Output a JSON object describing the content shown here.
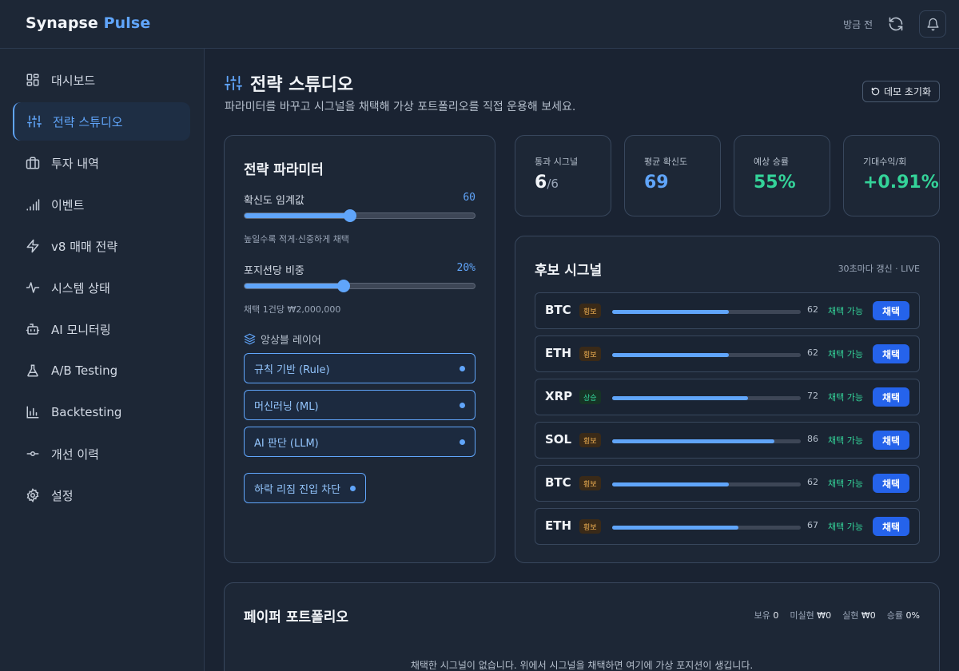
{
  "header": {
    "brand_main": "Synapse",
    "brand_accent": "Pulse",
    "updated": "방금 전",
    "refresh_icon": "refresh-icon",
    "bell_icon": "bell-icon"
  },
  "sidebar": {
    "items": [
      {
        "label": "대시보드",
        "icon": "dashboard-icon"
      },
      {
        "label": "전략 스튜디오",
        "icon": "sliders-icon",
        "active": true
      },
      {
        "label": "투자 내역",
        "icon": "briefcase-icon"
      },
      {
        "label": "이벤트",
        "icon": "signal-bars-icon"
      },
      {
        "label": "v8 매매 전략",
        "icon": "bolt-icon"
      },
      {
        "label": "시스템 상태",
        "icon": "activity-icon"
      },
      {
        "label": "AI 모니터링",
        "icon": "robot-icon"
      },
      {
        "label": "A/B Testing",
        "icon": "flask-icon"
      },
      {
        "label": "Backtesting",
        "icon": "bar-chart-icon"
      },
      {
        "label": "개선 이력",
        "icon": "commit-icon"
      },
      {
        "label": "설정",
        "icon": "gear-icon"
      }
    ]
  },
  "page": {
    "title": "전략 스튜디오",
    "subtitle": "파라미터를 바꾸고 시그널을 채택해 가상 포트폴리오를 직접 운용해 보세요.",
    "reset_label": "데모 초기화"
  },
  "params": {
    "title": "전략 파라미터",
    "confidence_label": "확신도 임계값",
    "confidence_value": "60",
    "confidence_fraction": 0.46,
    "confidence_hint": "높일수록 적게·신중하게 채택",
    "position_label": "포지션당 비중",
    "position_value": "20%",
    "position_fraction": 0.43,
    "position_hint": "채택 1건당 ₩2,000,000",
    "ensemble_label": "앙상블 레이어",
    "layers": [
      {
        "label": "규칙 기반 (Rule)"
      },
      {
        "label": "머신러닝 (ML)"
      },
      {
        "label": "AI 판단 (LLM)"
      }
    ],
    "regime_label": "하락 리짐 진입 차단"
  },
  "stats": [
    {
      "label": "통과 시그널",
      "value": "6",
      "sub": "/6",
      "color": "#f1f4f8"
    },
    {
      "label": "평균 확신도",
      "value": "69",
      "sub": "",
      "color": "#60a5fa"
    },
    {
      "label": "예상 승률",
      "value": "55%",
      "sub": "",
      "color": "#34d399"
    },
    {
      "label": "기대수익/회",
      "value": "+0.91%",
      "sub": "",
      "color": "#34d399"
    }
  ],
  "signals": {
    "title": "후보 시그널",
    "meta": "30초마다 갱신 · LIVE",
    "available_label": "채택 가능",
    "adopt_label": "채택",
    "rows": [
      {
        "symbol": "BTC",
        "badge": "횡보",
        "tone": "side",
        "confidence": 62
      },
      {
        "symbol": "ETH",
        "badge": "횡보",
        "tone": "side",
        "confidence": 62
      },
      {
        "symbol": "XRP",
        "badge": "상승",
        "tone": "up",
        "confidence": 72
      },
      {
        "symbol": "SOL",
        "badge": "횡보",
        "tone": "side",
        "confidence": 86
      },
      {
        "symbol": "BTC",
        "badge": "횡보",
        "tone": "side",
        "confidence": 62
      },
      {
        "symbol": "ETH",
        "badge": "횡보",
        "tone": "side",
        "confidence": 67
      }
    ]
  },
  "portfolio": {
    "title": "페이퍼 포트폴리오",
    "held_label": "보유",
    "held_value": "0",
    "unrealized_label": "미실현",
    "unrealized_value": "₩0",
    "realized_label": "실현",
    "realized_value": "₩0",
    "winrate_label": "승률",
    "winrate_value": "0%",
    "empty_text": "채택한 시그널이 없습니다. 위에서 시그널을 채택하면 여기에 가상 포지션이 생깁니다."
  }
}
